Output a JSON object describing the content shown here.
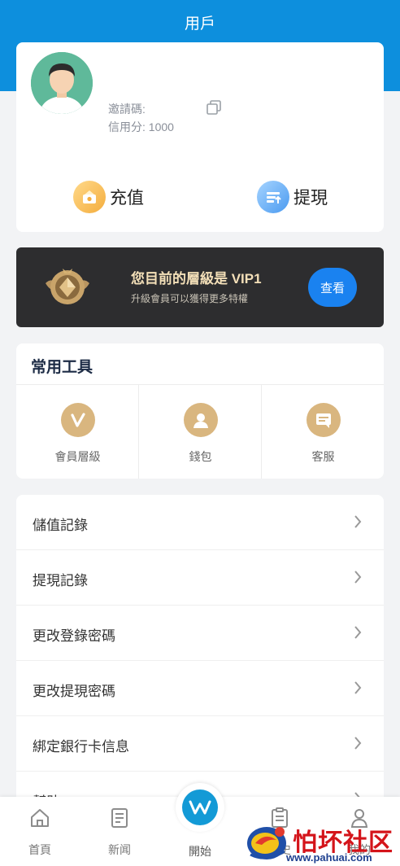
{
  "header": {
    "title": "用戶"
  },
  "user": {
    "invite_label": "邀請碼:",
    "credit_label": "信用分: 1000"
  },
  "actions": {
    "recharge": "充值",
    "withdraw": "提現"
  },
  "vip": {
    "title": "您目前的層級是 VIP1",
    "subtitle": "升級會員可以獲得更多特權",
    "button": "查看"
  },
  "tools": {
    "title": "常用工具",
    "items": [
      {
        "label": "會員層級",
        "icon": "v-icon"
      },
      {
        "label": "錢包",
        "icon": "person-icon"
      },
      {
        "label": "客服",
        "icon": "message-icon"
      }
    ]
  },
  "menu": {
    "items": [
      {
        "label": "儲值記錄"
      },
      {
        "label": "提現記錄"
      },
      {
        "label": "更改登錄密碼"
      },
      {
        "label": "更改提現密碼"
      },
      {
        "label": "綁定銀行卡信息"
      },
      {
        "label": "幫助"
      }
    ]
  },
  "tabbar": {
    "items": [
      {
        "label": "首頁",
        "icon": "home-icon"
      },
      {
        "label": "新闻",
        "icon": "news-icon"
      },
      {
        "label": "開始",
        "icon": "start-icon"
      },
      {
        "label": "歷史",
        "icon": "history-icon"
      },
      {
        "label": "我的",
        "icon": "profile-icon"
      }
    ]
  },
  "watermark": {
    "text": "怕坏社区",
    "url": "www.pahuai.com"
  },
  "colors": {
    "brand_blue": "#0d8fdd",
    "vip_bg": "#2d2d2f",
    "vip_gold": "#f3dfb8",
    "button_blue": "#1a82f0",
    "tool_gold": "#d9b67f"
  }
}
